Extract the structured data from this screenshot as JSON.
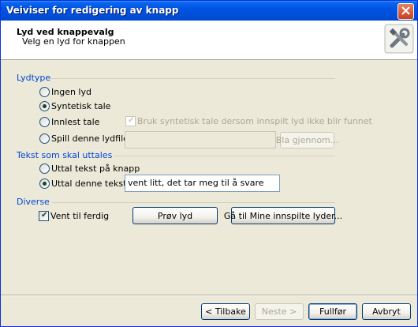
{
  "window": {
    "title": "Veiviser for redigering av knapp",
    "close_icon": "close-icon"
  },
  "header": {
    "title": "Lyd ved knappevalg",
    "subtitle": "Velg en lyd for knappen",
    "icon": "tools-icon"
  },
  "lydtype": {
    "group_label": "Lydtype",
    "options": [
      {
        "label": "Ingen lyd",
        "checked": false
      },
      {
        "label": "Syntetisk tale",
        "checked": true
      },
      {
        "label": "Innlest tale",
        "checked": false
      },
      {
        "label": "Spill denne lydfilen:",
        "checked": false
      }
    ],
    "fallback_checkbox_label": "Bruk syntetisk tale dersom innspilt lyd ikke blir funnet",
    "fallback_checked": true,
    "file_value": "",
    "browse_label": "Bla gjennom..."
  },
  "tekst": {
    "group_label": "Tekst som skal uttales",
    "options": [
      {
        "label": "Uttal tekst på knapp",
        "checked": false
      },
      {
        "label": "Uttal denne teksten:",
        "checked": true
      }
    ],
    "text_value": "vent litt, det tar meg til å svare"
  },
  "diverse": {
    "group_label": "Diverse",
    "wait_label": "Vent til ferdig",
    "wait_checked": true,
    "test_label": "Prøv lyd",
    "recorded_label": "Gå til Mine innspilte lyder..."
  },
  "footer": {
    "back_label": "< Tilbake",
    "next_label": "Neste >",
    "finish_label": "Fullfør",
    "cancel_label": "Avbryt"
  }
}
